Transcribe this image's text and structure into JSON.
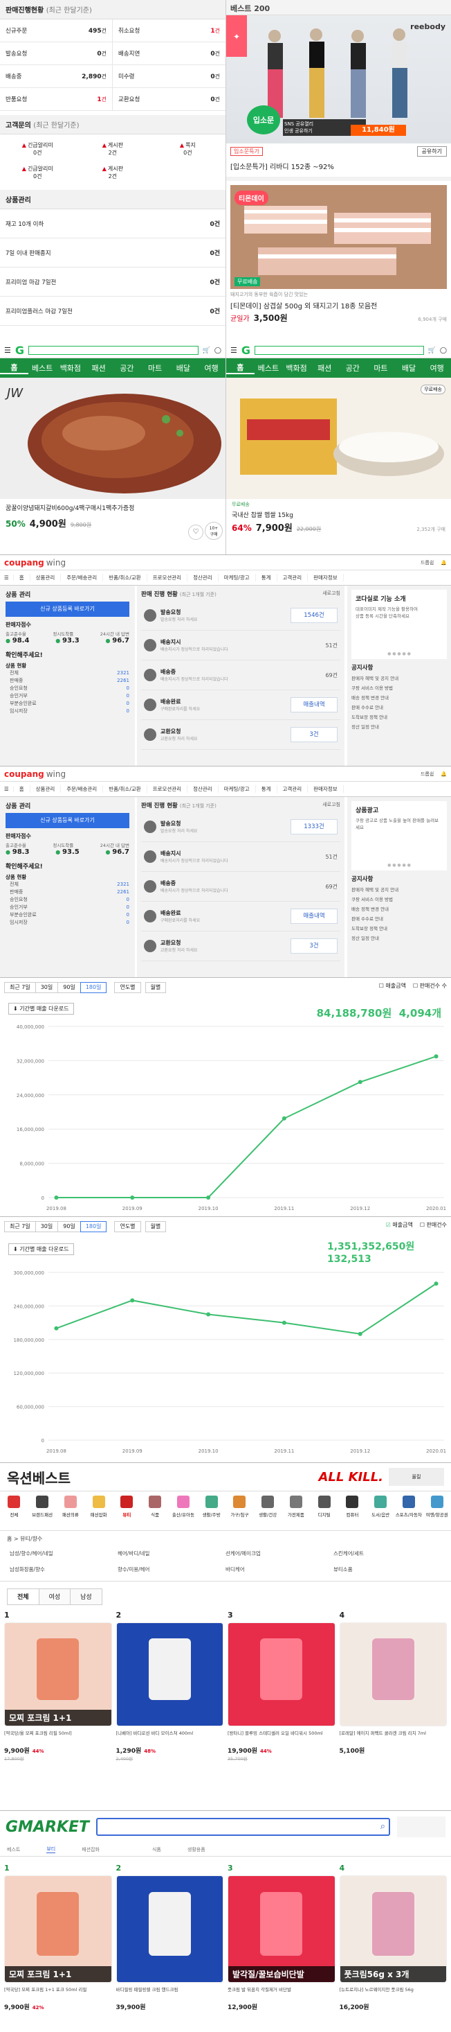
{
  "p1": {
    "sales_title": "판매진행현황",
    "sales_period": "(최근 한달기준)",
    "sales_grid": [
      {
        "label": "신규주문",
        "value": "495",
        "unit": "건",
        "red": false
      },
      {
        "label": "취소요청",
        "value": "1",
        "unit": "건",
        "red": true
      },
      {
        "label": "발송요청",
        "value": "0",
        "unit": "건",
        "red": false
      },
      {
        "label": "배송지연",
        "value": "0",
        "unit": "건",
        "red": false
      },
      {
        "label": "배송중",
        "value": "2,890",
        "unit": "건",
        "red": false
      },
      {
        "label": "미수령",
        "value": "0",
        "unit": "건",
        "red": false
      },
      {
        "label": "반품요청",
        "value": "1",
        "unit": "건",
        "red": true
      },
      {
        "label": "교환요청",
        "value": "0",
        "unit": "건",
        "red": false
      }
    ],
    "cs_title": "고객문의",
    "cs_period": "(최근 한달기준)",
    "cs_items": [
      {
        "label": "긴급알리미",
        "value": "0건"
      },
      {
        "label": "게시판",
        "value": "2건"
      },
      {
        "label": "쪽지",
        "value": "0건"
      },
      {
        "label": "긴급알리미",
        "value": "0건"
      },
      {
        "label": "게시판",
        "value": "2건"
      },
      {
        "label": "",
        "value": ""
      }
    ],
    "prod_title": "상품관리",
    "prod_rows": [
      {
        "label": "재고 10개 이하",
        "value": "0건"
      },
      {
        "label": "7일 이내 판매종지",
        "value": "0건"
      },
      {
        "label": "프리미엄 마감 7일전",
        "value": "0건"
      },
      {
        "label": "프리미엄플러스 마감 7일전",
        "value": "0건"
      }
    ]
  },
  "p2": {
    "title": "베스트 200",
    "badge": "입소문",
    "promo": "SNS 공유열리\n인생 공유하기",
    "brand": "reebody",
    "price_bar": "11,840원",
    "tag": "입소문특가",
    "link_btn": "공유하기",
    "caption": "[입소문특가] 리바디 152종 ~92%",
    "sub": "[입소문특가] 리바디 152종 ~92%",
    "note": "돼지고기의 동부한 육즙이 담긴 맛있는",
    "meat_title": "[티몬데이] 삼겹살 500g 외 돼지고기 18종 모음전",
    "meat_label": "균일가",
    "meat_price": "3,500원",
    "meat_sold": "6,904개 구매",
    "meat_logo": "티몬데이",
    "meat_badge": "무료배송"
  },
  "gm": {
    "nav": [
      "홈",
      "베스트",
      "백화점",
      "패션",
      "공간",
      "마트",
      "배달",
      "여행"
    ]
  },
  "p3": {
    "caption": "꿈꿀이양념돼지갈비600g/4팩구매시1팩추가증정",
    "rate": "50%",
    "price": "4,900원",
    "orig": "9,800원",
    "count": "10+\n구매"
  },
  "p4": {
    "caption": "국내산 찹쌀 멥쌀 15kg",
    "rate": "64%",
    "price": "7,900원",
    "orig": "22,000원",
    "sub": "무료배송",
    "sold": "2,352개 구매",
    "badge": "무료배송"
  },
  "cp": {
    "logo": "coupang",
    "logo2": "wing",
    "user": "드롭쉽",
    "nav": [
      "홈",
      "상품관리",
      "주문/배송관리",
      "반품/취소/교환",
      "프로모션관리",
      "정산관리",
      "마케팅/광고",
      "통계",
      "고객관리",
      "판매자정보"
    ],
    "mgmt_title": "상품 관리",
    "reg_btn": "신규 상품등록 바로가기",
    "sales_label": "판매자점수",
    "score_cols": [
      "출고준수율",
      "정시도착률",
      "24시간 내 답변"
    ],
    "scores_a": [
      "98.4",
      "93.3",
      "96.7"
    ],
    "scores_b": [
      "98.3",
      "93.5",
      "96.7"
    ],
    "check": "확인해주세요!",
    "status_title": "상품 현황",
    "status_items": [
      "전체",
      "판매중",
      "승인요청",
      "승인거부",
      "부분승인완료",
      "임시저장"
    ],
    "status_vals": [
      "2321",
      "2261",
      "0",
      "0",
      "0",
      "0"
    ],
    "flow_title": "판매 진행 현황",
    "flow_period": "(최근 1개월 기준)",
    "refresh": "새로고침",
    "flow": [
      {
        "label": "발송요청",
        "sub": "발송요청 처리 하세요"
      },
      {
        "label": "배송지시",
        "sub": "배송지시가 정상적으로 처리되었습니다"
      },
      {
        "label": "배송중",
        "sub": "배송지시가 정상적으로 처리되었습니다"
      },
      {
        "label": "배송완료",
        "sub": "구매완료처리를 하세요"
      },
      {
        "label": "교환요청",
        "sub": "교환요청 처리 하세요"
      }
    ],
    "flow_vals_a": [
      "1546건",
      "51건",
      "69건",
      "매출내역",
      "3건"
    ],
    "flow_vals_b": [
      "1333건",
      "51건",
      "69건",
      "매출내역",
      "3건"
    ],
    "ad_title": "코다실로 기능 소개",
    "ad_desc": "대표이미지 제작 기능을 활용하여 \n상품 등록 시간을 단축하세요",
    "ad2_title": "상품광고",
    "ad2_desc": "쿠팡 광고로 상품 노출을 높여 판매를 늘려보세요",
    "notice_title": "공지사항",
    "notices": [
      "판매자 혜택 및 공지 안내",
      "쿠팡 서비스 이용 방법",
      "배송 정책 변경 안내",
      "판매 수수료 안내",
      "도착보장 정책 안내",
      "정산 일정 안내"
    ]
  },
  "ch1": {
    "periods": [
      "최근 7일",
      "30일",
      "90일",
      "180일"
    ],
    "active": "180일",
    "year_sel": "연도별",
    "month_sel": "월별",
    "leg_total": "매출금액",
    "leg_avg": "판매건수 수",
    "total": "84,188,780원",
    "avg": "4,094개",
    "btn": "기간별 매출 다운로드"
  },
  "ch2": {
    "periods": [
      "최근 7일",
      "30일",
      "90일",
      "180일"
    ],
    "active": "180일",
    "year_sel": "연도별",
    "month_sel": "월별",
    "leg_total": "매출금액",
    "leg_avg": "판매건수",
    "total": "1,351,352,650원",
    "avg": "132,513",
    "btn": "기간별 매출 다운로드"
  },
  "chart_data": [
    {
      "type": "line",
      "x": [
        "2019.08",
        "2019.09",
        "2019.10",
        "2019.11",
        "2019.12",
        "2020.01"
      ],
      "y": [
        0,
        0,
        0,
        18500000,
        27000000,
        33000000
      ],
      "ylim": [
        0,
        40000000
      ],
      "yticks": [
        "40,000,000",
        "32,000,000",
        "24,000,000",
        "16,000,000",
        "8,000,000",
        "0"
      ]
    },
    {
      "type": "line",
      "x": [
        "2019.08",
        "2019.09",
        "2019.10",
        "2019.11",
        "2019.12",
        "2020.01"
      ],
      "y": [
        200000000,
        250000000,
        225000000,
        210000000,
        190000000,
        280000000
      ],
      "ylim": [
        0,
        300000000
      ],
      "yticks": [
        "300,000,000",
        "240,000,000",
        "180,000,000",
        "120,000,000",
        "60,000,000",
        "0"
      ]
    }
  ],
  "ok": {
    "title": "옥션베스트",
    "allkill": "ALL KILL.",
    "allkill_sub": "올킬",
    "cats": [
      "전체",
      "브랜드패션",
      "패션의류",
      "패션잡화",
      "뷰티",
      "식품",
      "출산/유아동",
      "생활/주방",
      "가구/침구",
      "생활/건강",
      "가전제품",
      "디지털",
      "컴퓨터",
      "도서/음반",
      "스포츠/자동차",
      "여행/항공권"
    ],
    "cat_on": "뷰티",
    "crumb": "홈 > 뷰티/향수",
    "sub_cats": [
      "남성/향수/헤어/네일",
      "헤어/바디/네일",
      "선케어/메이크업",
      "스킨케어/세트",
      "남성화장품/향수",
      "향수/미용/헤어",
      "바디케어",
      "뷰티소품"
    ],
    "tabs": [
      "전체",
      "여성",
      "남성"
    ],
    "items": [
      {
        "rank": "1",
        "label": "모찌 포크림 1+1",
        "name": "[약국당/올 모찌 포크림 리필 50ml]",
        "price": "9,900원",
        "rate": "44%",
        "orig": "17,800원"
      },
      {
        "rank": "2",
        "label": "",
        "name": "[니베아] 바디로션 바디 모이스쳐 400ml",
        "price": "1,290원",
        "rate": "48%",
        "orig": "2,490원"
      },
      {
        "rank": "3",
        "label": "",
        "name": "[왕타니] 블루밍 스테디셀러 오일 바디워시 500ml",
        "price": "19,900원",
        "rate": "44%",
        "orig": "35,700원"
      },
      {
        "rank": "4",
        "label": "",
        "name": "[로레알] 에이지 퍼펙트 콜라겐 크림 리치 7ml",
        "price": "5,100원",
        "rate": "",
        "orig": ""
      }
    ]
  },
  "gm2": {
    "logo": "GMARKET",
    "tabs": [
      "베스트",
      "뷰티",
      "패션잡화",
      "",
      "식품",
      "생활용품"
    ],
    "items": [
      {
        "rank": "1",
        "label": "모찌 포크림 1+1",
        "name": "[약국당] 모찌 포크림 1+1 포크 50ml 리필",
        "price": "9,900원",
        "rate": "42%"
      },
      {
        "rank": "2",
        "label": "",
        "name": "바디필링 때필링젤 크림 핸드크림",
        "price": "39,900원",
        "rate": ""
      },
      {
        "rank": "3",
        "label": "발각질/꿀보습비단발",
        "name": "풋크림 발 뒤꿈치 각질제거 비단발",
        "price": "12,900원",
        "rate": ""
      },
      {
        "rank": "4",
        "label": "풋크림56g x 3개",
        "name": "[뉴트로지나] 노르웨이지안 풋크림 56g",
        "price": "16,200원",
        "rate": ""
      }
    ]
  },
  "colors": {
    "g_green": "#1b8f3f",
    "red": "#e0001b",
    "blue": "#2f6ee0",
    "coupang_red": "#e22",
    "chart_green": "#3cbf6f"
  }
}
